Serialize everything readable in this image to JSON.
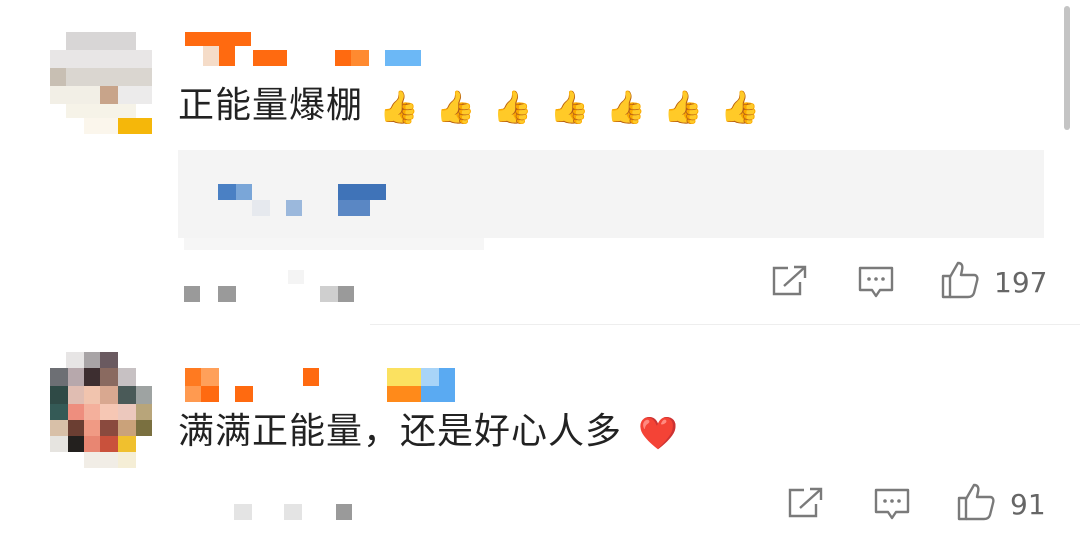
{
  "comments": [
    {
      "text": "正能量爆棚",
      "emoji": [
        "👍",
        "👍",
        "👍",
        "👍",
        "👍",
        "👍",
        "👍"
      ],
      "likes": "197"
    },
    {
      "text": "满满正能量，还是好心人多",
      "emoji": [
        "❤️"
      ],
      "likes": "91"
    }
  ],
  "icons": {
    "share": "share-icon",
    "comment": "comment-icon",
    "like": "thumbs-up-icon"
  },
  "colors": {
    "username_orange": "#ff6600",
    "username_blue": "#5ab0f5",
    "reply_blue": "#4a7fc0",
    "heart": "#e8302f"
  }
}
